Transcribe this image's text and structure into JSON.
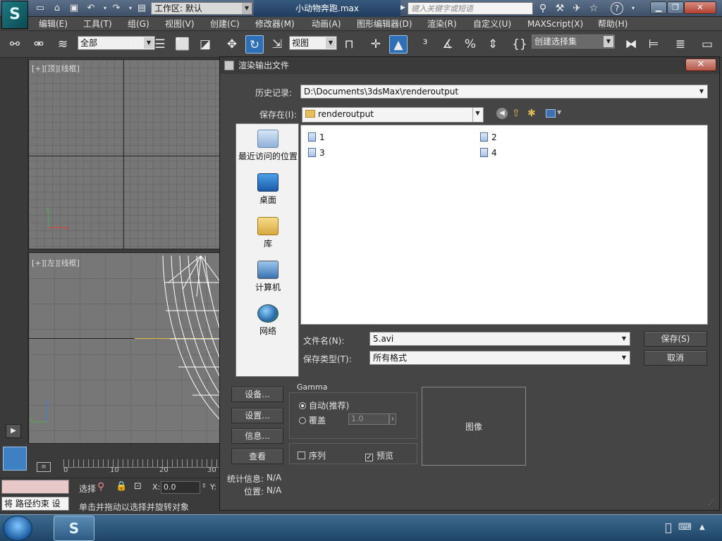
{
  "app": {
    "workspace": "工作区: 默认",
    "document_title": "小动物奔跑.max",
    "search_placeholder": "键入关键字或短语"
  },
  "menu": [
    "编辑(E)",
    "工具(T)",
    "组(G)",
    "视图(V)",
    "创建(C)",
    "修改器(M)",
    "动画(A)",
    "图形编辑器(D)",
    "渲染(R)",
    "自定义(U)",
    "MAXScript(X)",
    "帮助(H)"
  ],
  "toolbar": {
    "selection_filter": "全部",
    "reference_coord": "视图",
    "named_selection": "创建选择集"
  },
  "viewports": {
    "top_label": "[+][顶][线框]",
    "left_label": "[+][左][线框]"
  },
  "timeline": {
    "ticks": [
      "0",
      "10",
      "20",
      "30"
    ]
  },
  "status": {
    "script_text": "将 路径约束 设",
    "selection_label": "选择",
    "x_label": "X:",
    "x_value": "0.0",
    "y_label": "Y:",
    "prompt": "单击并拖动以选择并旋转对象"
  },
  "dialog": {
    "title": "渲染输出文件",
    "close": "✕",
    "history_label": "历史记录:",
    "history_value": "D:\\Documents\\3dsMax\\renderoutput",
    "save_in_label": "保存在(I):",
    "save_in_value": "renderoutput",
    "places": [
      {
        "label": "最近访问的位置",
        "icon": "recent-places-icon"
      },
      {
        "label": "桌面",
        "icon": "desktop-icon"
      },
      {
        "label": "库",
        "icon": "libraries-icon"
      },
      {
        "label": "计算机",
        "icon": "computer-icon"
      },
      {
        "label": "网络",
        "icon": "network-icon"
      }
    ],
    "files": [
      "1",
      "2",
      "3",
      "4"
    ],
    "filename_label": "文件名(N):",
    "filename_value": "5.avi",
    "filetype_label": "保存类型(T):",
    "filetype_value": "所有格式",
    "save_button": "保存(S)",
    "cancel_button": "取消",
    "setup_button": "设备...",
    "settings_button": "设置...",
    "info_button": "信息...",
    "view_button": "查看",
    "gamma_title": "Gamma",
    "gamma_auto": "自动(推荐)",
    "gamma_override": "覆盖",
    "gamma_value": "1.0",
    "sequence_label": "序列",
    "sequence_checked": false,
    "preview_label": "预览",
    "preview_checked": true,
    "image_label": "图像",
    "stats_label": "统计信息:",
    "stats_value": "N/A",
    "location_label": "位置:",
    "location_value": "N/A"
  }
}
